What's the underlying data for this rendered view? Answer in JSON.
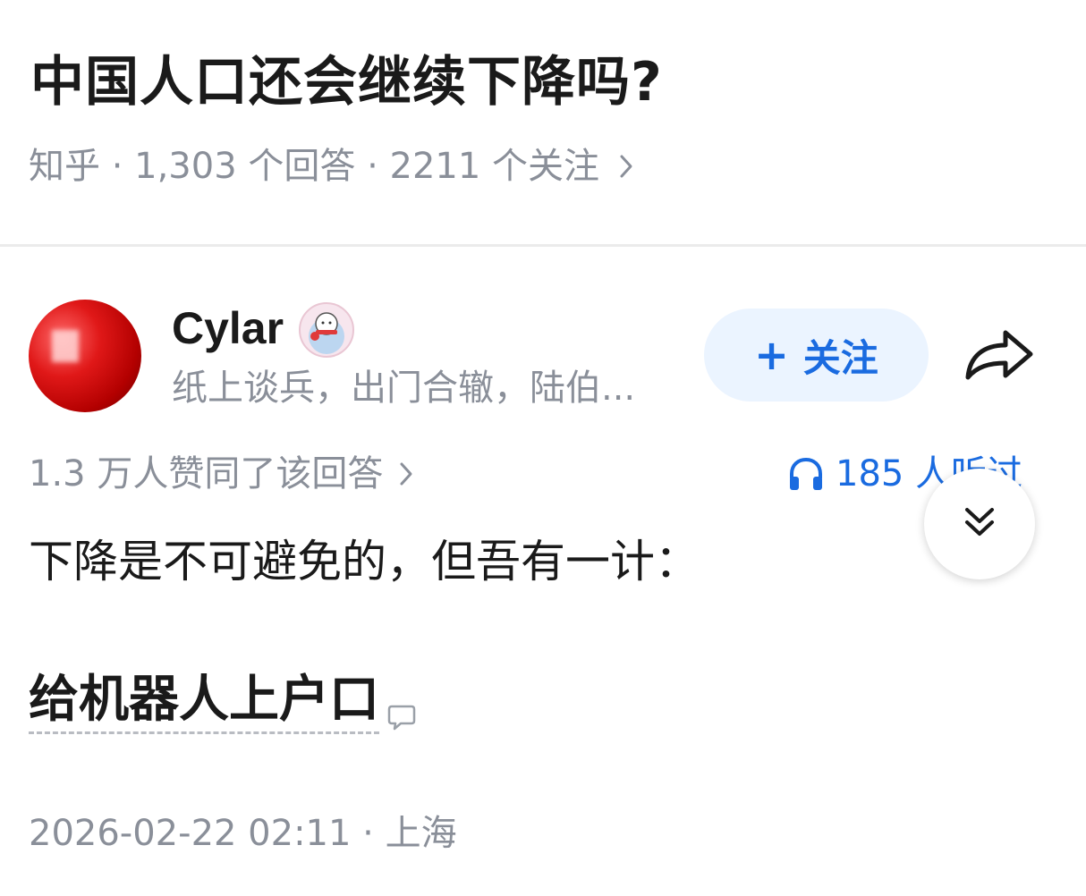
{
  "question": {
    "title": "中国人口还会继续下降吗?",
    "meta": "知乎 · 1,303 个回答 · 2211 个关注"
  },
  "author": {
    "name": "Cylar",
    "bio": "纸上谈兵，出门合辙，陆伯...",
    "follow_label": "关注"
  },
  "answer": {
    "votes": "1.3 万人赞同了该回答",
    "listeners": "185 人听过",
    "paragraph": "下降是不可避免的，但吾有一计：",
    "highlight": "给机器人上户口",
    "footer": "2026-02-22 02:11 · 上海"
  },
  "colors": {
    "accent": "#1a6be0",
    "follow_bg": "#ebf4ff",
    "meta_text": "#8a8f99"
  },
  "icons": [
    "chevron-right-icon",
    "share-icon",
    "headphones-icon",
    "double-chevron-down-icon",
    "comment-icon",
    "verified-badge-icon"
  ]
}
